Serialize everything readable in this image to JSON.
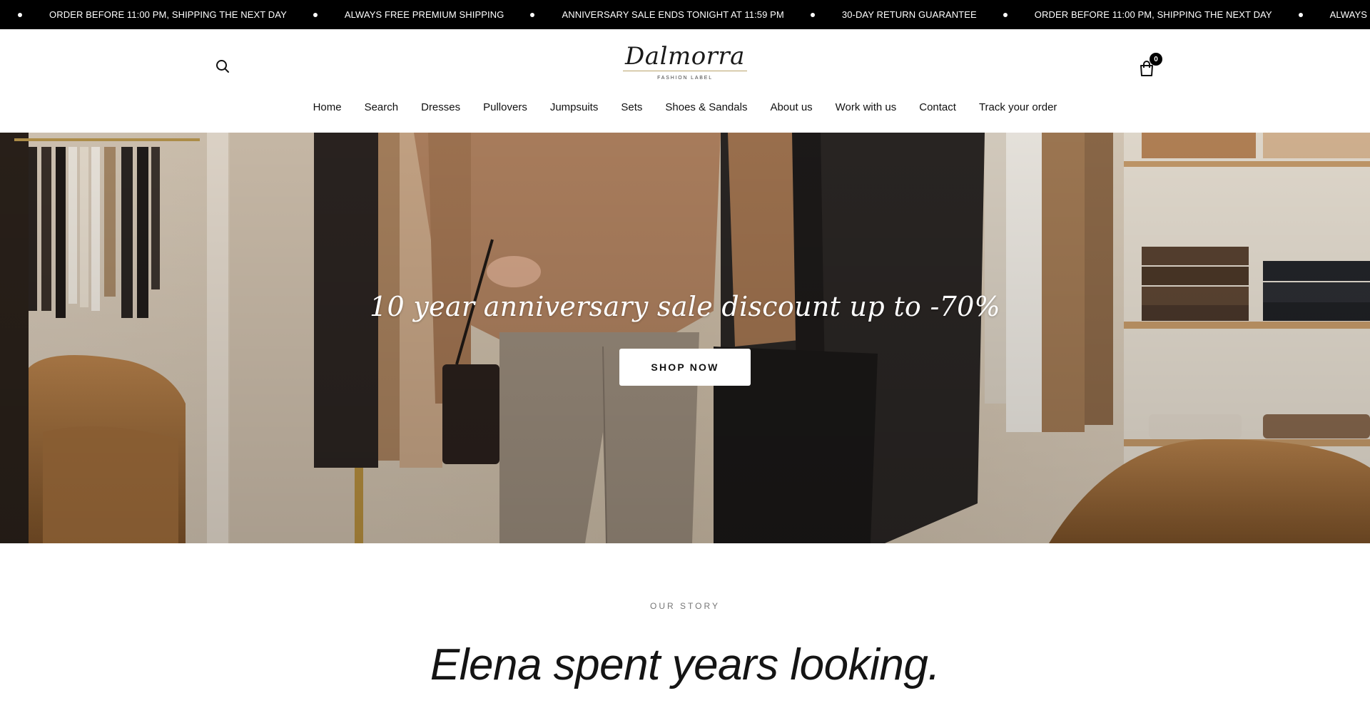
{
  "announcement": {
    "items": [
      "ORDER BEFORE 11:00 PM, SHIPPING THE NEXT DAY",
      "ALWAYS FREE PREMIUM SHIPPING",
      "ANNIVERSARY SALE ENDS TONIGHT AT 11:59 PM",
      "30-DAY RETURN GUARANTEE",
      "ORDER BEFORE 11:00 PM, SHIPPING THE NEXT DAY",
      "ALWAYS FREE PREMIUM SHIPPING"
    ]
  },
  "header": {
    "logo": {
      "name": "Dalmorra",
      "tagline": "FASHION LABEL"
    },
    "search_icon": "search-icon",
    "cart": {
      "icon": "shopping-bag-icon",
      "count": "0"
    }
  },
  "nav": {
    "items": [
      "Home",
      "Search",
      "Dresses",
      "Pullovers",
      "Jumpsuits",
      "Sets",
      "Shoes & Sandals",
      "About us",
      "Work with us",
      "Contact",
      "Track your order"
    ]
  },
  "hero": {
    "title": "10 year anniversary sale discount up to -70%",
    "cta_label": "SHOP NOW"
  },
  "story": {
    "eyebrow": "OUR STORY",
    "headline": "Elena spent years looking."
  },
  "colors": {
    "announcement_bg": "#000000",
    "accent_gold": "#b8a26a",
    "hero_warm": "#c49a6c"
  }
}
